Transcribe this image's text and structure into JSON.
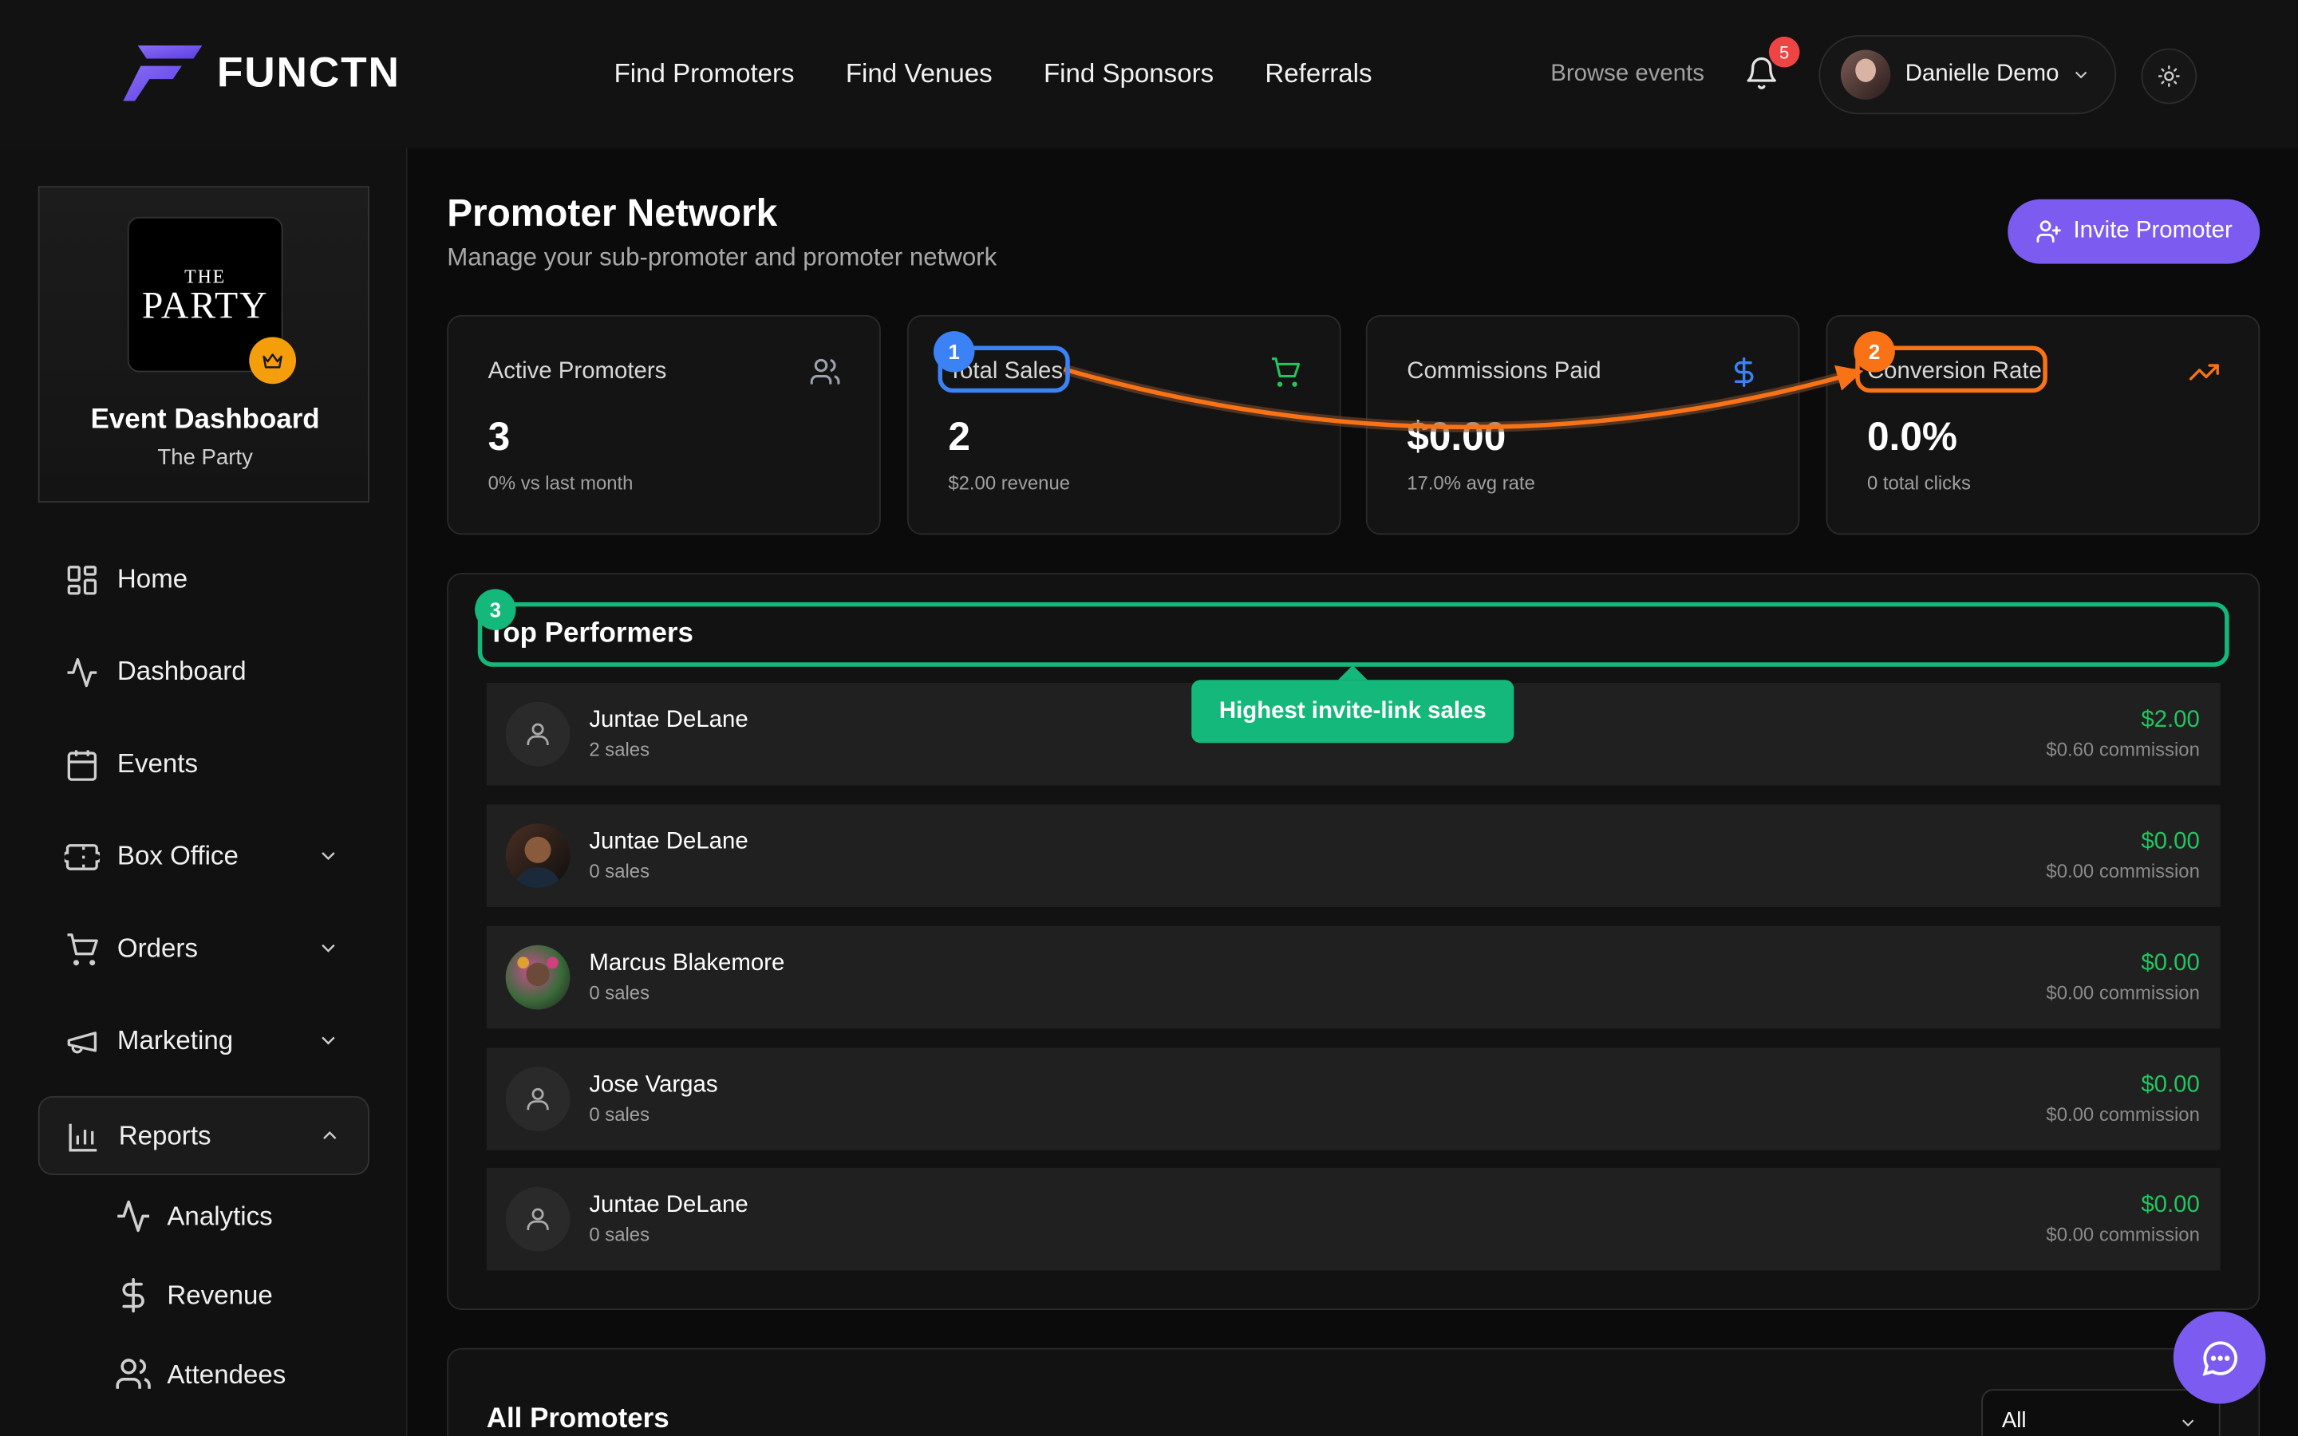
{
  "header": {
    "logo_text": "FUNCTN",
    "nav": [
      "Find Promoters",
      "Find Venues",
      "Find Sponsors",
      "Referrals"
    ],
    "browse_label": "Browse events",
    "notification_count": "5",
    "user_name": "Danielle Demo"
  },
  "sidebar": {
    "event_thumb_top": "THE",
    "event_thumb_main": "PARTY",
    "event_title": "Event Dashboard",
    "event_name": "The Party",
    "items": [
      "Home",
      "Dashboard",
      "Events",
      "Box Office",
      "Orders",
      "Marketing",
      "Reports"
    ],
    "sub_items": [
      "Analytics",
      "Revenue",
      "Attendees"
    ]
  },
  "main": {
    "title": "Promoter Network",
    "subtitle": "Manage your sub-promoter and promoter network",
    "invite_label": "Invite Promoter",
    "stats": [
      {
        "title": "Active Promoters",
        "value": "3",
        "sub": "0% vs last month"
      },
      {
        "title": "Total Sales",
        "value": "2",
        "sub": "$2.00 revenue"
      },
      {
        "title": "Commissions Paid",
        "value": "$0.00",
        "sub": "17.0% avg rate"
      },
      {
        "title": "Conversion Rate",
        "value": "0.0%",
        "sub": "0 total clicks"
      }
    ],
    "top_title": "Top Performers",
    "performers": [
      {
        "name": "Juntae DeLane",
        "sales": "2 sales",
        "amount": "$2.00",
        "commission": "$0.60 commission"
      },
      {
        "name": "Juntae DeLane",
        "sales": "0 sales",
        "amount": "$0.00",
        "commission": "$0.00 commission"
      },
      {
        "name": "Marcus Blakemore",
        "sales": "0 sales",
        "amount": "$0.00",
        "commission": "$0.00 commission"
      },
      {
        "name": "Jose Vargas",
        "sales": "0 sales",
        "amount": "$0.00",
        "commission": "$0.00 commission"
      },
      {
        "name": "Juntae DeLane",
        "sales": "0 sales",
        "amount": "$0.00",
        "commission": "$0.00 commission"
      }
    ],
    "all_title": "All Promoters",
    "filter_value": "All"
  },
  "annotations": {
    "badges": [
      "1",
      "2",
      "3"
    ],
    "tooltip": "Highest invite-link sales",
    "colors": {
      "blue": "#3b82f6",
      "orange": "#f97316",
      "green": "#14b87a"
    }
  },
  "colors": {
    "accent": "#7c5cf0",
    "positive": "#22c55e",
    "crown": "#f59e0b",
    "alert": "#ef4444"
  }
}
